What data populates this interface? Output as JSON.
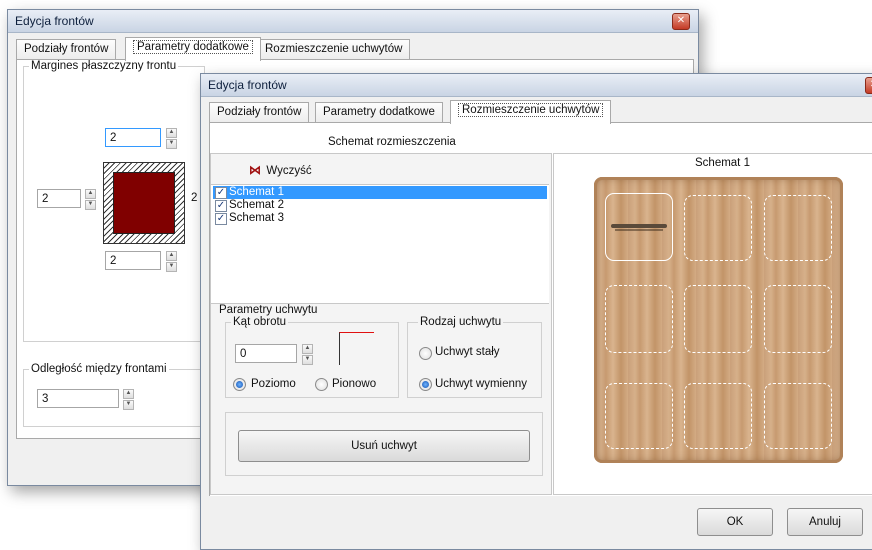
{
  "back_window": {
    "title": "Edycja frontów",
    "close_glyph": "✕",
    "tabs": [
      {
        "label": "Podziały frontów"
      },
      {
        "label": "Parametry dodatkowe"
      },
      {
        "label": "Rozmieszczenie uchwytów"
      }
    ],
    "margin_group": {
      "legend": "Margines płaszczyzny frontu",
      "top_value": "2",
      "left_value": "2",
      "right_value": "2",
      "bottom_value": "2"
    },
    "spacing_group": {
      "legend": "Odległość między frontami",
      "value": "3"
    }
  },
  "front_window": {
    "title": "Edycja frontów",
    "tabs": [
      {
        "label": "Podziały frontów"
      },
      {
        "label": "Parametry dodatkowe"
      },
      {
        "label": "Rozmieszczenie uchwytów"
      }
    ],
    "section_title": "Schemat rozmieszczenia",
    "clear_label": "Wyczyść",
    "schemes": [
      {
        "label": "Schemat 1",
        "checked": true,
        "selected": true
      },
      {
        "label": "Schemat 2",
        "checked": true,
        "selected": false
      },
      {
        "label": "Schemat 3",
        "checked": true,
        "selected": false
      }
    ],
    "handle_params": {
      "legend": "Parametry uchwytu",
      "angle_legend": "Kąt obrotu",
      "angle_value": "0",
      "horizontal_label": "Poziomo",
      "vertical_label": "Pionowo",
      "orientation_selected": "Poziomo",
      "type_legend": "Rodzaj uchwytu",
      "fixed_label": "Uchwyt stały",
      "replaceable_label": "Uchwyt wymienny",
      "type_selected": "Uchwyt wymienny",
      "remove_button": "Usuń uchwyt"
    },
    "preview_title": "Schemat 1",
    "handle_slots": 9,
    "selected_slot": 1,
    "ok_label": "OK",
    "cancel_label": "Anuluj",
    "colors": {
      "front_fill": "#800000",
      "selection": "#3399ff"
    }
  }
}
